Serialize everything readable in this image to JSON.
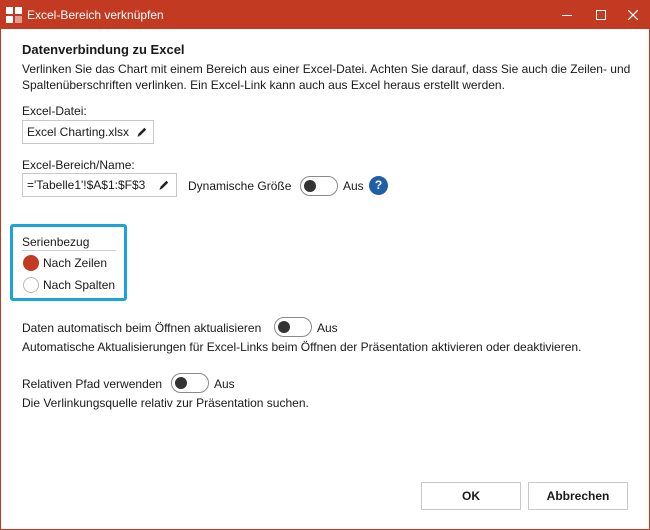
{
  "window": {
    "title": "Excel-Bereich verknüpfen",
    "accent_color": "#c23a22",
    "icons": {
      "app": "powerpoint-link-icon",
      "minimize": "minimize-icon",
      "maximize": "maximize-icon",
      "close": "close-icon"
    }
  },
  "section": {
    "heading": "Datenverbindung zu Excel",
    "description": "Verlinken Sie das Chart mit einem Bereich aus einer Excel-Datei. Achten Sie darauf, dass Sie auch die Zeilen- und Spaltenüberschriften verlinken. Ein Excel-Link kann auch aus Excel heraus erstellt werden."
  },
  "excel_file": {
    "label": "Excel-Datei:",
    "value": "Excel Charting.xlsx",
    "edit_icon": "pencil-icon"
  },
  "excel_range": {
    "label": "Excel-Bereich/Name:",
    "value": "='Tabelle1'!$A$1:$F$3",
    "edit_icon": "pencil-icon",
    "dynamic_size_label": "Dynamische Größe",
    "dynamic_size_state": "Aus",
    "help_glyph": "?",
    "help_color": "#1f5fa8"
  },
  "series": {
    "title": "Serienbezug",
    "options": [
      {
        "label": "Nach Zeilen",
        "selected": true
      },
      {
        "label": "Nach Spalten",
        "selected": false
      }
    ],
    "highlight_color": "#1aa3dd"
  },
  "auto_update": {
    "label": "Daten automatisch beim Öffnen aktualisieren",
    "state": "Aus",
    "description": "Automatische Aktualisierungen für Excel-Links beim Öffnen der Präsentation aktivieren oder deaktivieren."
  },
  "relative_path": {
    "label": "Relativen Pfad verwenden",
    "state": "Aus",
    "description": "Die Verlinkungsquelle relativ zur Präsentation suchen."
  },
  "buttons": {
    "ok": "OK",
    "cancel": "Abbrechen"
  }
}
